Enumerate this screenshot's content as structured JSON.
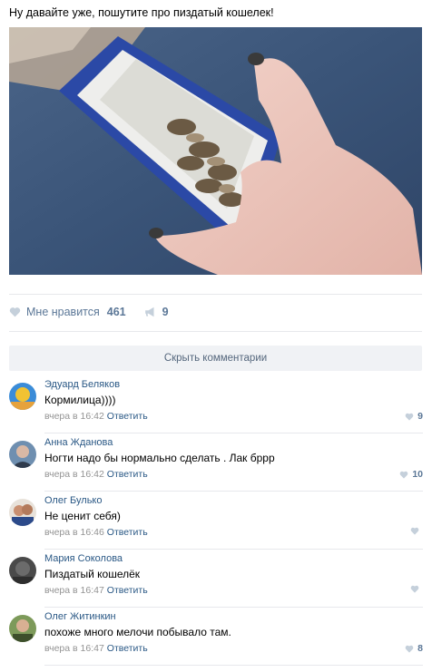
{
  "post": {
    "text": "Ну давайте уже, пошутите про пиздатый кошелек!",
    "photo_icon": "wallet-photo"
  },
  "actions": {
    "like_label": "Мне нравится",
    "like_count": "461",
    "share_count": "9"
  },
  "hide_comments_label": "Скрыть комментарии",
  "comments": [
    {
      "author": "Эдуард Беляков",
      "text": "Кормилица))))",
      "time": "вчера в 16:42",
      "reply": "Ответить",
      "likes": "9"
    },
    {
      "author": "Анна Жданова",
      "text": "Ногти надо бы нормально сделать . Лак бррр",
      "time": "вчера в 16:42",
      "reply": "Ответить",
      "likes": "10"
    },
    {
      "author": "Олег Булько",
      "text": "Не ценит себя)",
      "time": "вчера в 16:46",
      "reply": "Ответить",
      "likes": ""
    },
    {
      "author": "Мария Соколова",
      "text": "Пиздатый кошелёк",
      "time": "вчера в 16:47",
      "reply": "Ответить",
      "likes": ""
    },
    {
      "author": "Олег Житинкин",
      "text": "похоже много мелочи побывало там.",
      "time": "вчера в 16:47",
      "reply": "Ответить",
      "likes": "8"
    }
  ],
  "colors": {
    "link": "#2a5885",
    "muted": "#939393",
    "accent": "#5b7797"
  }
}
